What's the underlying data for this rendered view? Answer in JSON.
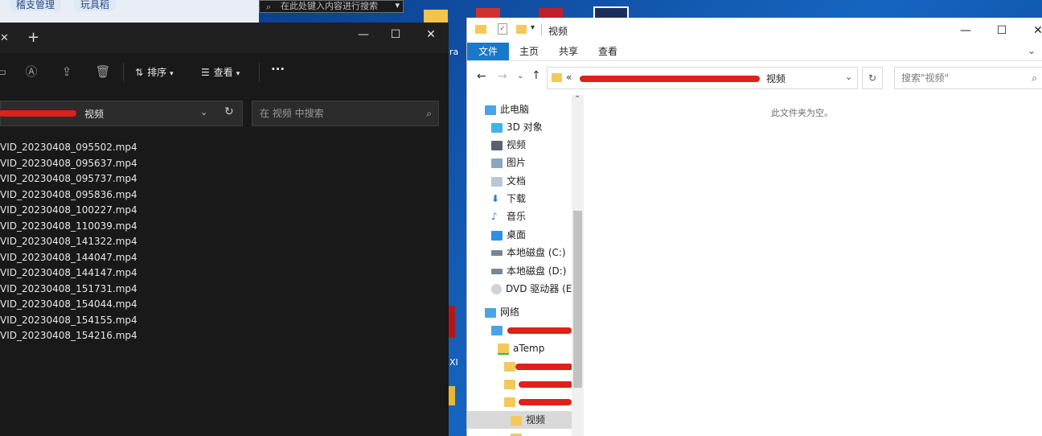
{
  "top_left": {
    "tags": [
      "稽支管理",
      "玩具稻"
    ]
  },
  "taskbar_search": {
    "placeholder": "在此处键入内容进行搜索"
  },
  "dark_explorer": {
    "toolbar": {
      "sort_label": "排序",
      "view_label": "查看",
      "more_label": "···"
    },
    "address": {
      "current_folder": "视频"
    },
    "search": {
      "placeholder": "在 视频 中搜索"
    },
    "files": [
      "VID_20230408_095502.mp4",
      "VID_20230408_095637.mp4",
      "VID_20230408_095737.mp4",
      "VID_20230408_095836.mp4",
      "VID_20230408_100227.mp4",
      "VID_20230408_110039.mp4",
      "VID_20230408_141322.mp4",
      "VID_20230408_144047.mp4",
      "VID_20230408_144147.mp4",
      "VID_20230408_151731.mp4",
      "VID_20230408_154044.mp4",
      "VID_20230408_154155.mp4",
      "VID_20230408_154216.mp4"
    ]
  },
  "light_explorer": {
    "title": "视频",
    "ribbon_tabs": [
      "文件",
      "主页",
      "共享",
      "查看"
    ],
    "address": {
      "prefix": "«",
      "current_folder": "视频"
    },
    "search": {
      "placeholder": "搜索\"视频\""
    },
    "nav": {
      "this_pc": "此电脑",
      "items": [
        "3D 对象",
        "视频",
        "图片",
        "文档",
        "下载",
        "音乐",
        "桌面",
        "本地磁盘 (C:)",
        "本地磁盘 (D:)",
        "DVD 驱动器 (E:)"
      ],
      "network": "网络",
      "atemp": "aTemp",
      "selected": "视频"
    },
    "empty_message": "此文件夹为空。"
  },
  "desktop_fragments": [
    "ra",
    "XI"
  ],
  "colors": {
    "accent_blue": "#1979ca",
    "dark_bg": "#191919",
    "redaction_red": "#e0201a"
  }
}
